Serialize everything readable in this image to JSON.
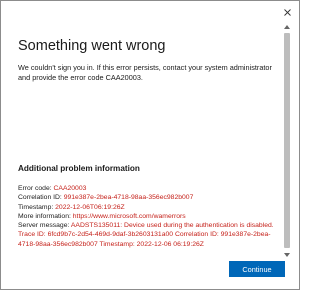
{
  "dialog": {
    "close_icon": "close-icon",
    "heading": "Something went wrong",
    "message": "We couldn't sign you in. If this error persists, contact your system administrator and provide the error code CAA20003."
  },
  "details": {
    "heading": "Additional problem information",
    "error_code_label": "Error code: ",
    "error_code": "CAA20003",
    "correlation_label": "Correlation ID: ",
    "correlation_id": "991e387e-2bea-4718-98aa-356ec982b007",
    "timestamp_label": "Timestamp: ",
    "timestamp": "2022-12-06T06:19:26Z",
    "more_info_label": "More information: ",
    "more_info_url": "https://www.microsoft.com/wamerrors",
    "server_message_label": "Server message: ",
    "server_message": "AADSTS135011: Device used during the authentication is disabled. Trace ID: 6fcd9b7c-2d54-469d-9daf-3b2603131a00 Correlation ID: 991e387e-2bea-4718-98aa-356ec982b007 Timestamp: 2022-12-06 06:19:26Z"
  },
  "footer": {
    "continue_label": "Continue"
  },
  "colors": {
    "accent": "#0067b8",
    "error_text": "#c5211a"
  }
}
